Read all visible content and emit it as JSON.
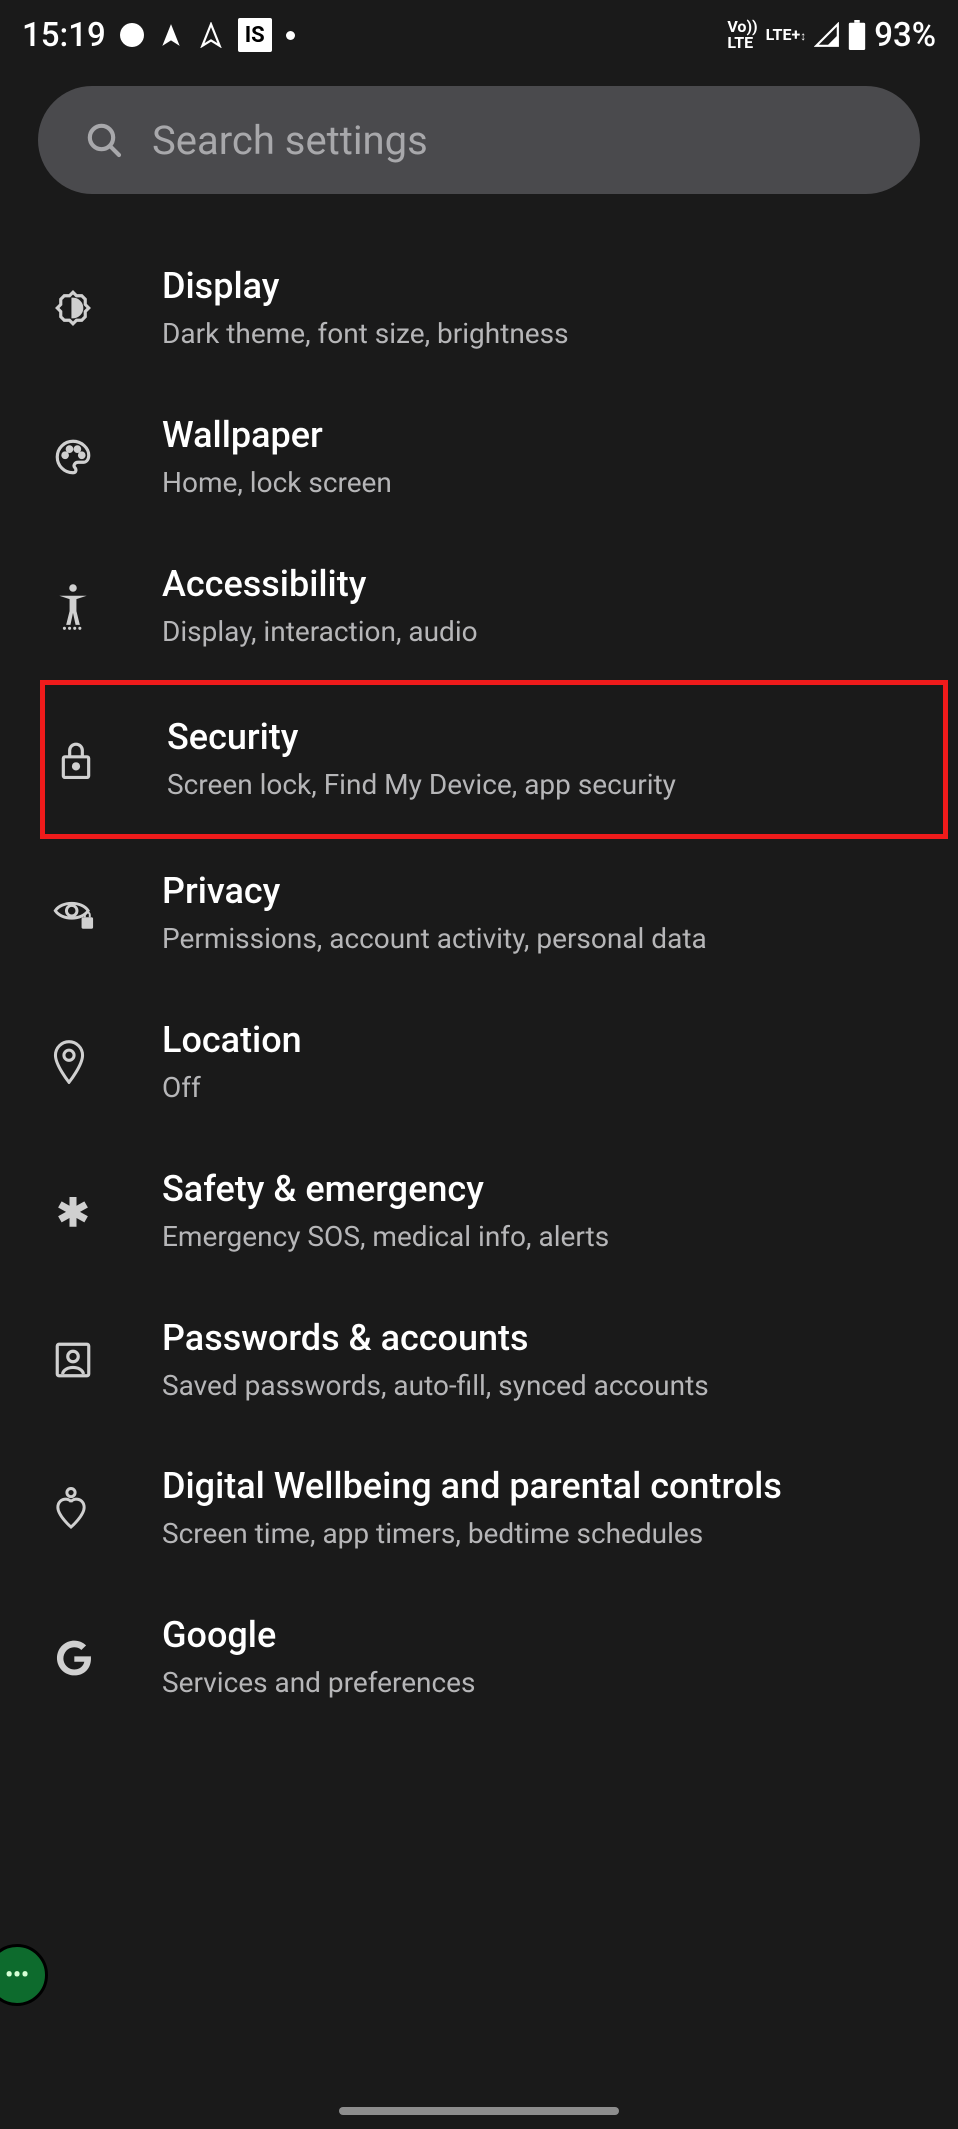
{
  "statusbar": {
    "time": "15:19",
    "app_badge": "IS",
    "net1": "Vo))",
    "net2": "LTE",
    "net3": "LTE+",
    "battery_pct": "93%"
  },
  "search": {
    "placeholder": "Search settings"
  },
  "items": [
    {
      "icon": "brightness",
      "title": "Display",
      "subtitle": "Dark theme, font size, brightness",
      "highlight": false,
      "name": "display"
    },
    {
      "icon": "palette",
      "title": "Wallpaper",
      "subtitle": "Home, lock screen",
      "highlight": false,
      "name": "wallpaper"
    },
    {
      "icon": "accessibility",
      "title": "Accessibility",
      "subtitle": "Display, interaction, audio",
      "highlight": false,
      "name": "accessibility"
    },
    {
      "icon": "lock",
      "title": "Security",
      "subtitle": "Screen lock, Find My Device, app security",
      "highlight": true,
      "name": "security"
    },
    {
      "icon": "privacy",
      "title": "Privacy",
      "subtitle": "Permissions, account activity, personal data",
      "highlight": false,
      "name": "privacy"
    },
    {
      "icon": "location",
      "title": "Location",
      "subtitle": "Off",
      "highlight": false,
      "name": "location"
    },
    {
      "icon": "medical",
      "title": "Safety & emergency",
      "subtitle": "Emergency SOS, medical info, alerts",
      "highlight": false,
      "name": "safety"
    },
    {
      "icon": "account",
      "title": "Passwords & accounts",
      "subtitle": "Saved passwords, auto-fill, synced accounts",
      "highlight": false,
      "name": "passwords"
    },
    {
      "icon": "wellbeing",
      "title": "Digital Wellbeing and parental controls",
      "subtitle": "Screen time, app timers, bedtime schedules",
      "highlight": false,
      "name": "wellbeing"
    },
    {
      "icon": "google",
      "title": "Google",
      "subtitle": "Services and preferences",
      "highlight": false,
      "name": "google"
    }
  ]
}
